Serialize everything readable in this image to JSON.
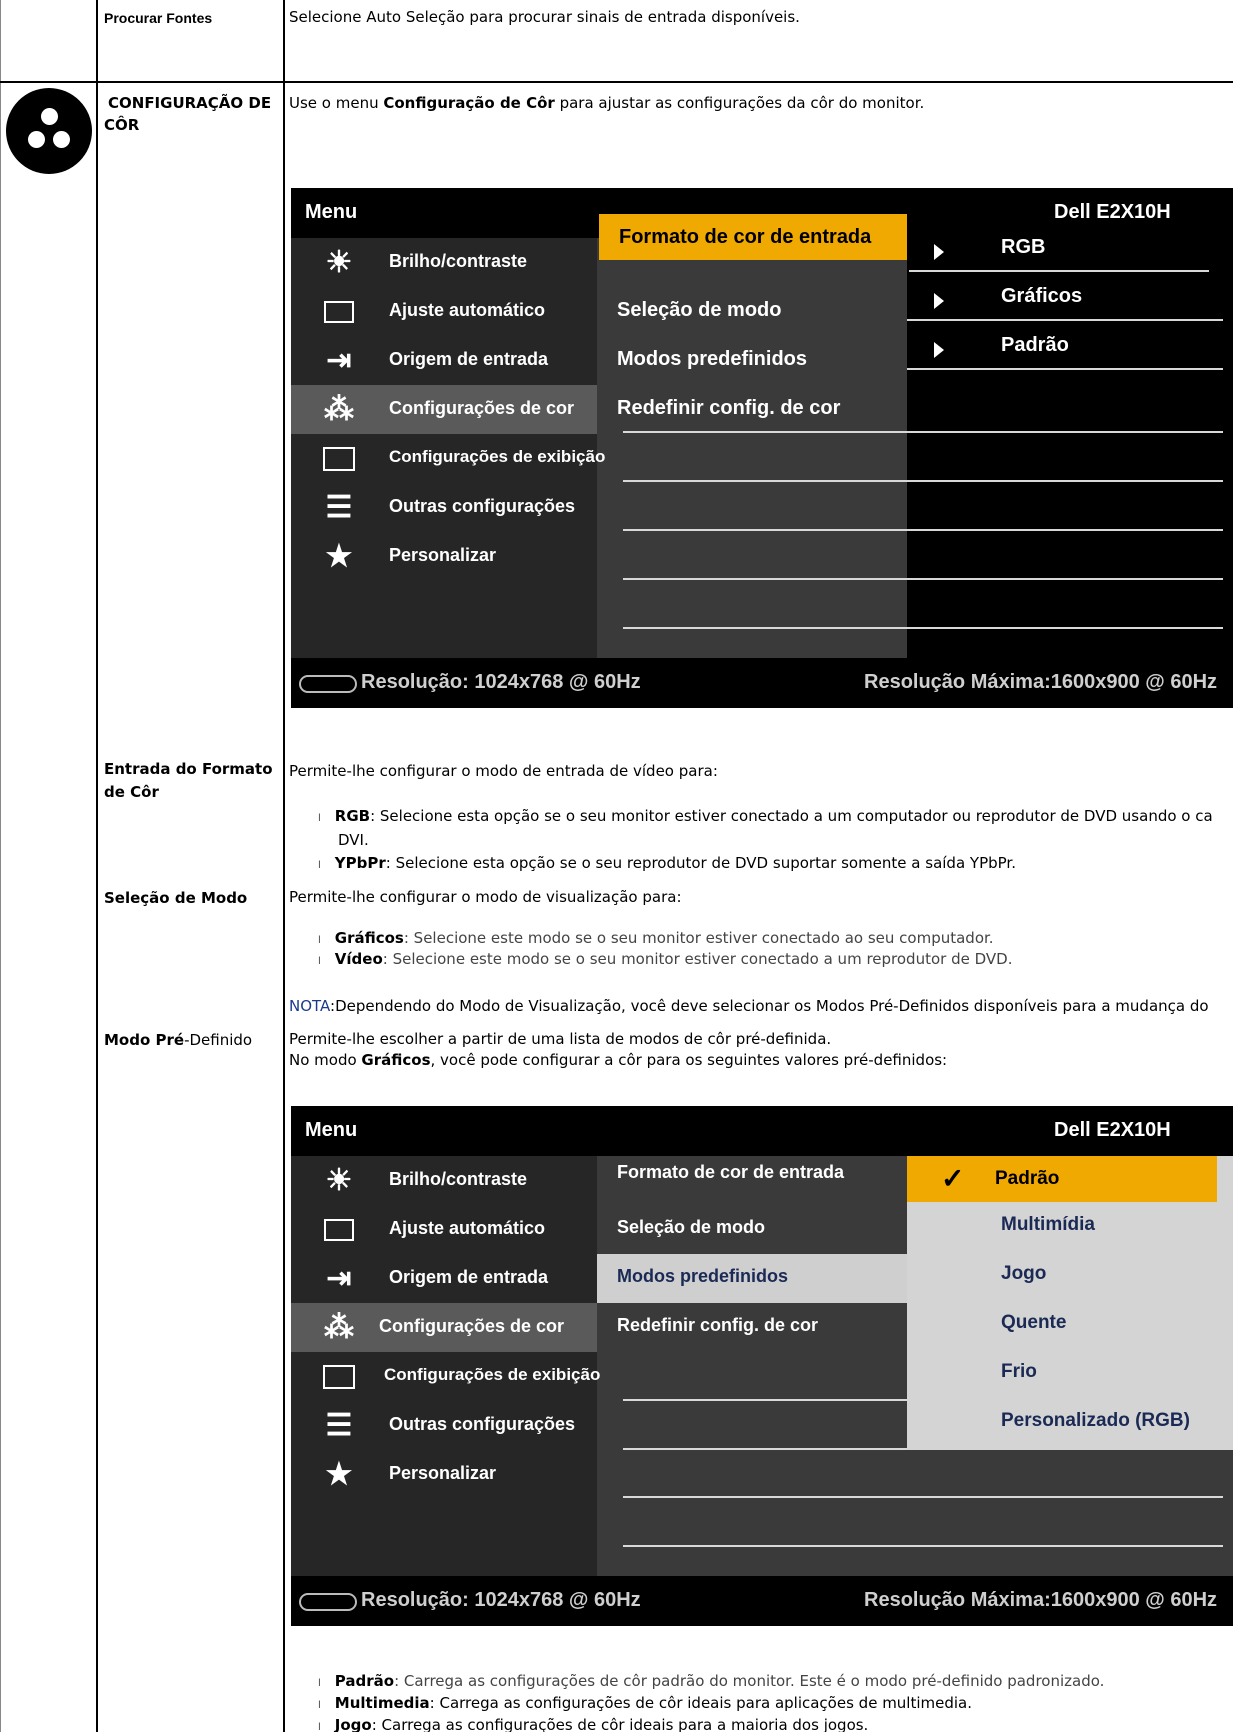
{
  "row_procurar": {
    "label": "Procurar Fontes",
    "desc": "Selecione Auto Seleção para procurar sinais de entrada disponíveis."
  },
  "section": {
    "label_line1": "CONFIGURAÇÃO DE",
    "label_line2": "CÔR",
    "desc_prefix": "Use o menu ",
    "desc_bold": "Configuração de Côr",
    "desc_suffix": " para ajustar as configurações da côr do monitor."
  },
  "osd": {
    "menu_title": "Menu",
    "model": "Dell E2X10H",
    "menu_items": [
      {
        "icon": "sun-icon",
        "label": "Brilho/contraste"
      },
      {
        "icon": "auto-adjust-icon",
        "label": "Ajuste automático"
      },
      {
        "icon": "input-source-icon",
        "label": "Origem de entrada"
      },
      {
        "icon": "color-dots-icon",
        "label": "Configurações de cor"
      },
      {
        "icon": "display-icon",
        "label": "Configurações de exibição"
      },
      {
        "icon": "sliders-icon",
        "label": "Outras configurações"
      },
      {
        "icon": "star-icon",
        "label": "Personalizar"
      }
    ],
    "submenu": [
      "Formato de cor de entrada",
      "Seleção de modo",
      "Modos predefinidos",
      "Redefinir config. de cor"
    ],
    "values1": [
      "RGB",
      "Gráficos",
      "Padrão"
    ],
    "options2": [
      "Padrão",
      "Multimídia",
      "Jogo",
      "Quente",
      "Frio",
      "Personalizado (RGB)"
    ],
    "resolution": "Resolução: 1024x768 @ 60Hz",
    "max_resolution": "Resolução Máxima:1600x900 @ 60Hz",
    "colors": {
      "highlight": "#f0a900",
      "bg": "#000000"
    }
  },
  "entrada": {
    "label_line1": "Entrada do Formato",
    "label_line2": "de Côr",
    "intro": "Permite-lhe configurar o modo de entrada de vídeo para:",
    "b1_bold": "RGB",
    "b1_text": ": Selecione esta opção se o seu monitor estiver conectado a um computador ou reprodutor de DVD usando o ca",
    "b1_wrap": "DVI.",
    "b2_bold": "YPbPr",
    "b2_text": ": Selecione esta opção se o seu reprodutor de DVD suportar somente a saída YPbPr."
  },
  "selecao": {
    "label": "Seleção de Modo",
    "intro": "Permite-lhe configurar o modo de visualização para:",
    "b1_bold": "Gráficos",
    "b1_text": ": Selecione este modo se o seu monitor estiver conectado ao seu computador.",
    "b2_bold": "Vídeo",
    "b2_text": ": Selecione este modo se o seu monitor estiver conectado a um reprodutor de DVD."
  },
  "nota": {
    "label": "NOTA",
    "text": ":Dependendo do Modo de Visualização, você deve selecionar os Modos Pré-Definidos disponíveis para a mudança do"
  },
  "modo": {
    "label_bold": "Modo Pré",
    "label_rest": "-Definido",
    "line1": "Permite-lhe escolher a partir de uma lista de modos de côr pré-definida.",
    "line2_prefix": "No modo ",
    "line2_bold": "Gráficos",
    "line2_suffix": ", você pode configurar a côr para os seguintes valores pré-definidos:"
  },
  "bottom": {
    "b1_bold": "Padrão",
    "b1_text": ": Carrega as configurações de côr padrão do monitor. Este é o modo pré-definido padronizado.",
    "b2_bold": "Multimedia",
    "b2_text": ": Carrega as configurações de côr ideais para aplicações de multimedia.",
    "b3_bold": "Jogo",
    "b3_text": ": Carrega as configurações de côr ideais para a maioria dos jogos."
  }
}
